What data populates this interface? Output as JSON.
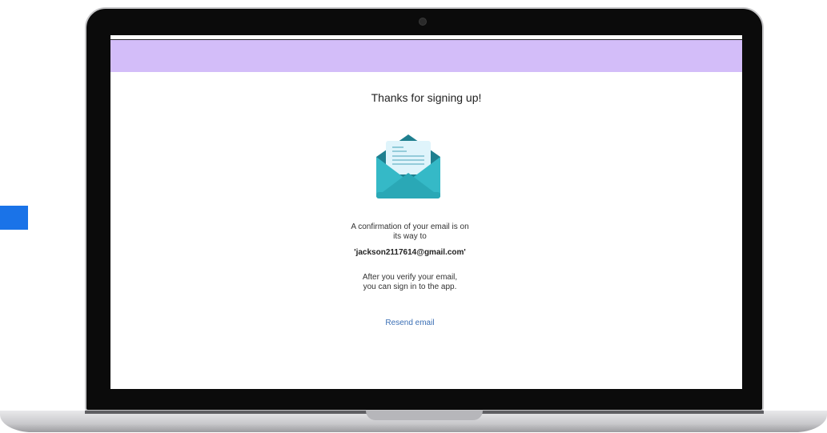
{
  "screen": {
    "header_color": "#d3bdf9",
    "title": "Thanks for signing up!",
    "icon": "envelope-letter-icon",
    "confirmation_line1": "A confirmation of your email is on",
    "confirmation_line2": "its way to",
    "email": "'jackson2117614@gmail.com'",
    "verify_line1": "After you verify your email,",
    "verify_line2": "you can sign in to the app.",
    "resend_label": "Resend email"
  },
  "colors": {
    "accent": "#1a73e8",
    "link": "#3b6fb5",
    "envelope": "#35b9c7"
  }
}
